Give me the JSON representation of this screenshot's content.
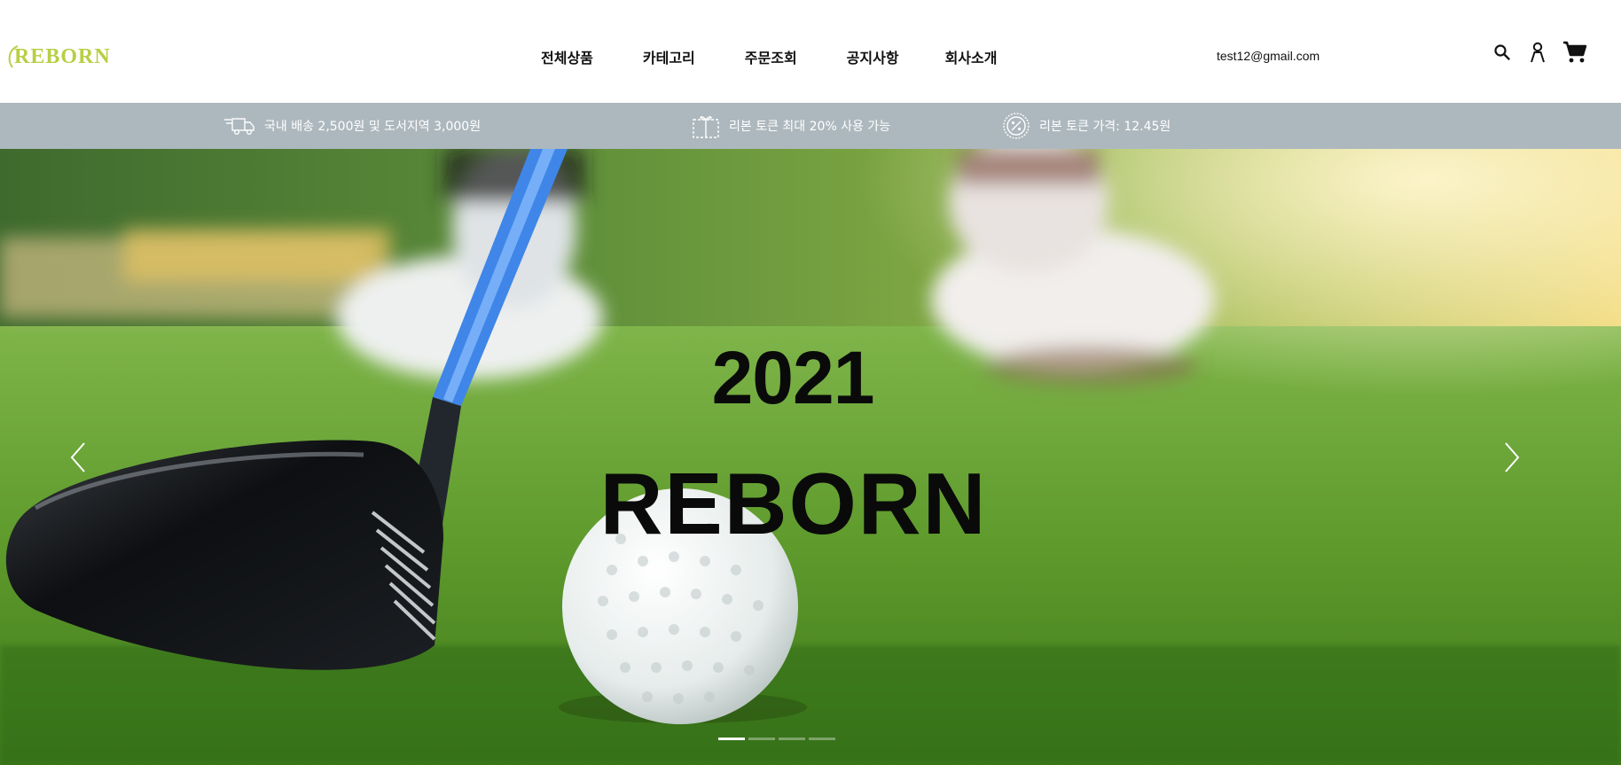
{
  "header": {
    "logo_text": "REBORN",
    "nav": [
      {
        "label": "전체상품"
      },
      {
        "label": "카테고리"
      },
      {
        "label": "주문조회"
      },
      {
        "label": "공지사항"
      },
      {
        "label": "회사소개"
      }
    ],
    "user_email": "test12@gmail.com",
    "icons": [
      "search-icon",
      "user-icon",
      "cart-icon"
    ]
  },
  "infobar": {
    "items": [
      {
        "icon": "delivery-truck-icon",
        "text": "국내 배송 2,500원 및 도서지역 3,000원"
      },
      {
        "icon": "gift-coupon-icon",
        "text": "리본 토큰 최대 20% 사용 가능"
      },
      {
        "icon": "percent-badge-icon",
        "text": "리본 토큰 가격: 12.45원"
      }
    ]
  },
  "hero": {
    "year": "2021",
    "title": "REBORN",
    "slide_count": 4,
    "active_slide": 1
  },
  "colors": {
    "logo": "#b7cf45",
    "infobar_bg": "#adb8be",
    "hero_text": "#0a0a0a"
  }
}
